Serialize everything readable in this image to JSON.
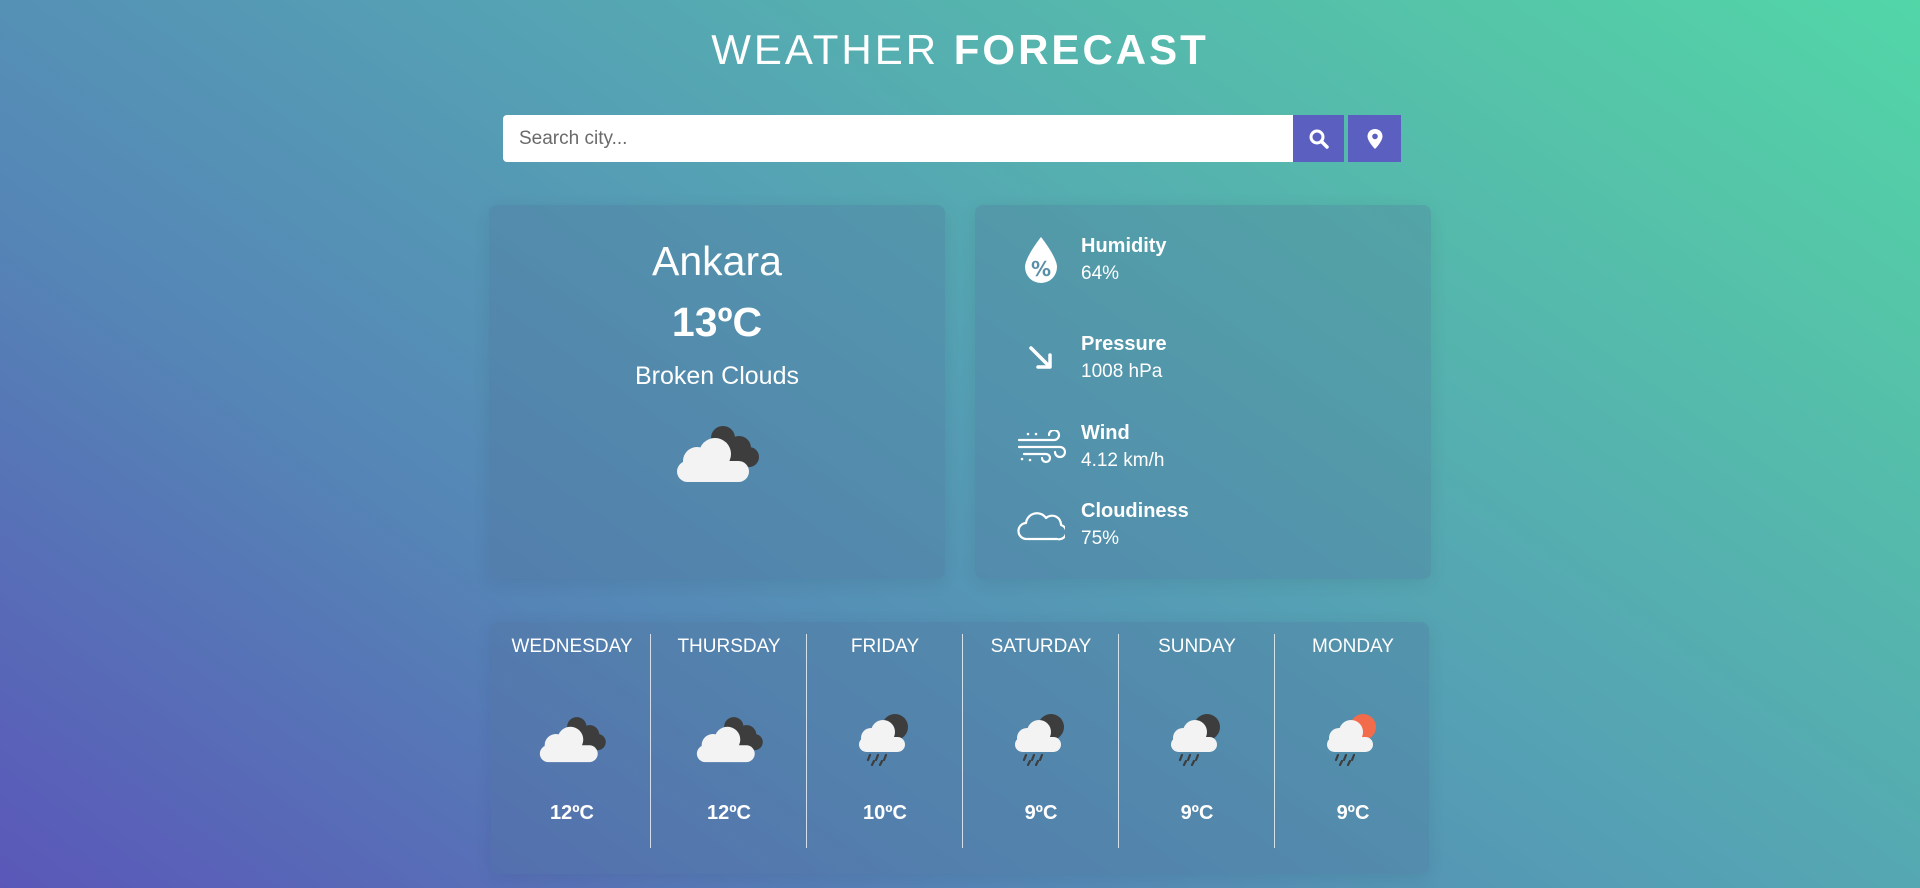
{
  "header": {
    "title_light": "WEATHER",
    "title_bold": "FORECAST"
  },
  "search": {
    "placeholder": "Search city...",
    "value": ""
  },
  "current": {
    "city": "Ankara",
    "temperature": "13ºC",
    "description": "Broken Clouds",
    "icon": "broken-clouds-icon"
  },
  "details": [
    {
      "label": "Humidity",
      "value": "64%",
      "icon": "humidity-icon"
    },
    {
      "label": "Pressure",
      "value": "1008 hPa",
      "icon": "pressure-icon"
    },
    {
      "label": "Wind",
      "value": "4.12 km/h",
      "icon": "wind-icon"
    },
    {
      "label": "Cloudiness",
      "value": "75%",
      "icon": "cloudiness-icon"
    }
  ],
  "forecast": [
    {
      "day": "WEDNESDAY",
      "temp": "12ºC",
      "icon": "broken-clouds-icon"
    },
    {
      "day": "THURSDAY",
      "temp": "12ºC",
      "icon": "broken-clouds-icon"
    },
    {
      "day": "FRIDAY",
      "temp": "10ºC",
      "icon": "rain-cloud-icon"
    },
    {
      "day": "SATURDAY",
      "temp": "9ºC",
      "icon": "rain-cloud-icon"
    },
    {
      "day": "SUNDAY",
      "temp": "9ºC",
      "icon": "rain-cloud-icon"
    },
    {
      "day": "MONDAY",
      "temp": "9ºC",
      "icon": "sun-rain-cloud-icon"
    }
  ],
  "colors": {
    "button": "#5b5fbf",
    "sun": "#f26b4b"
  }
}
